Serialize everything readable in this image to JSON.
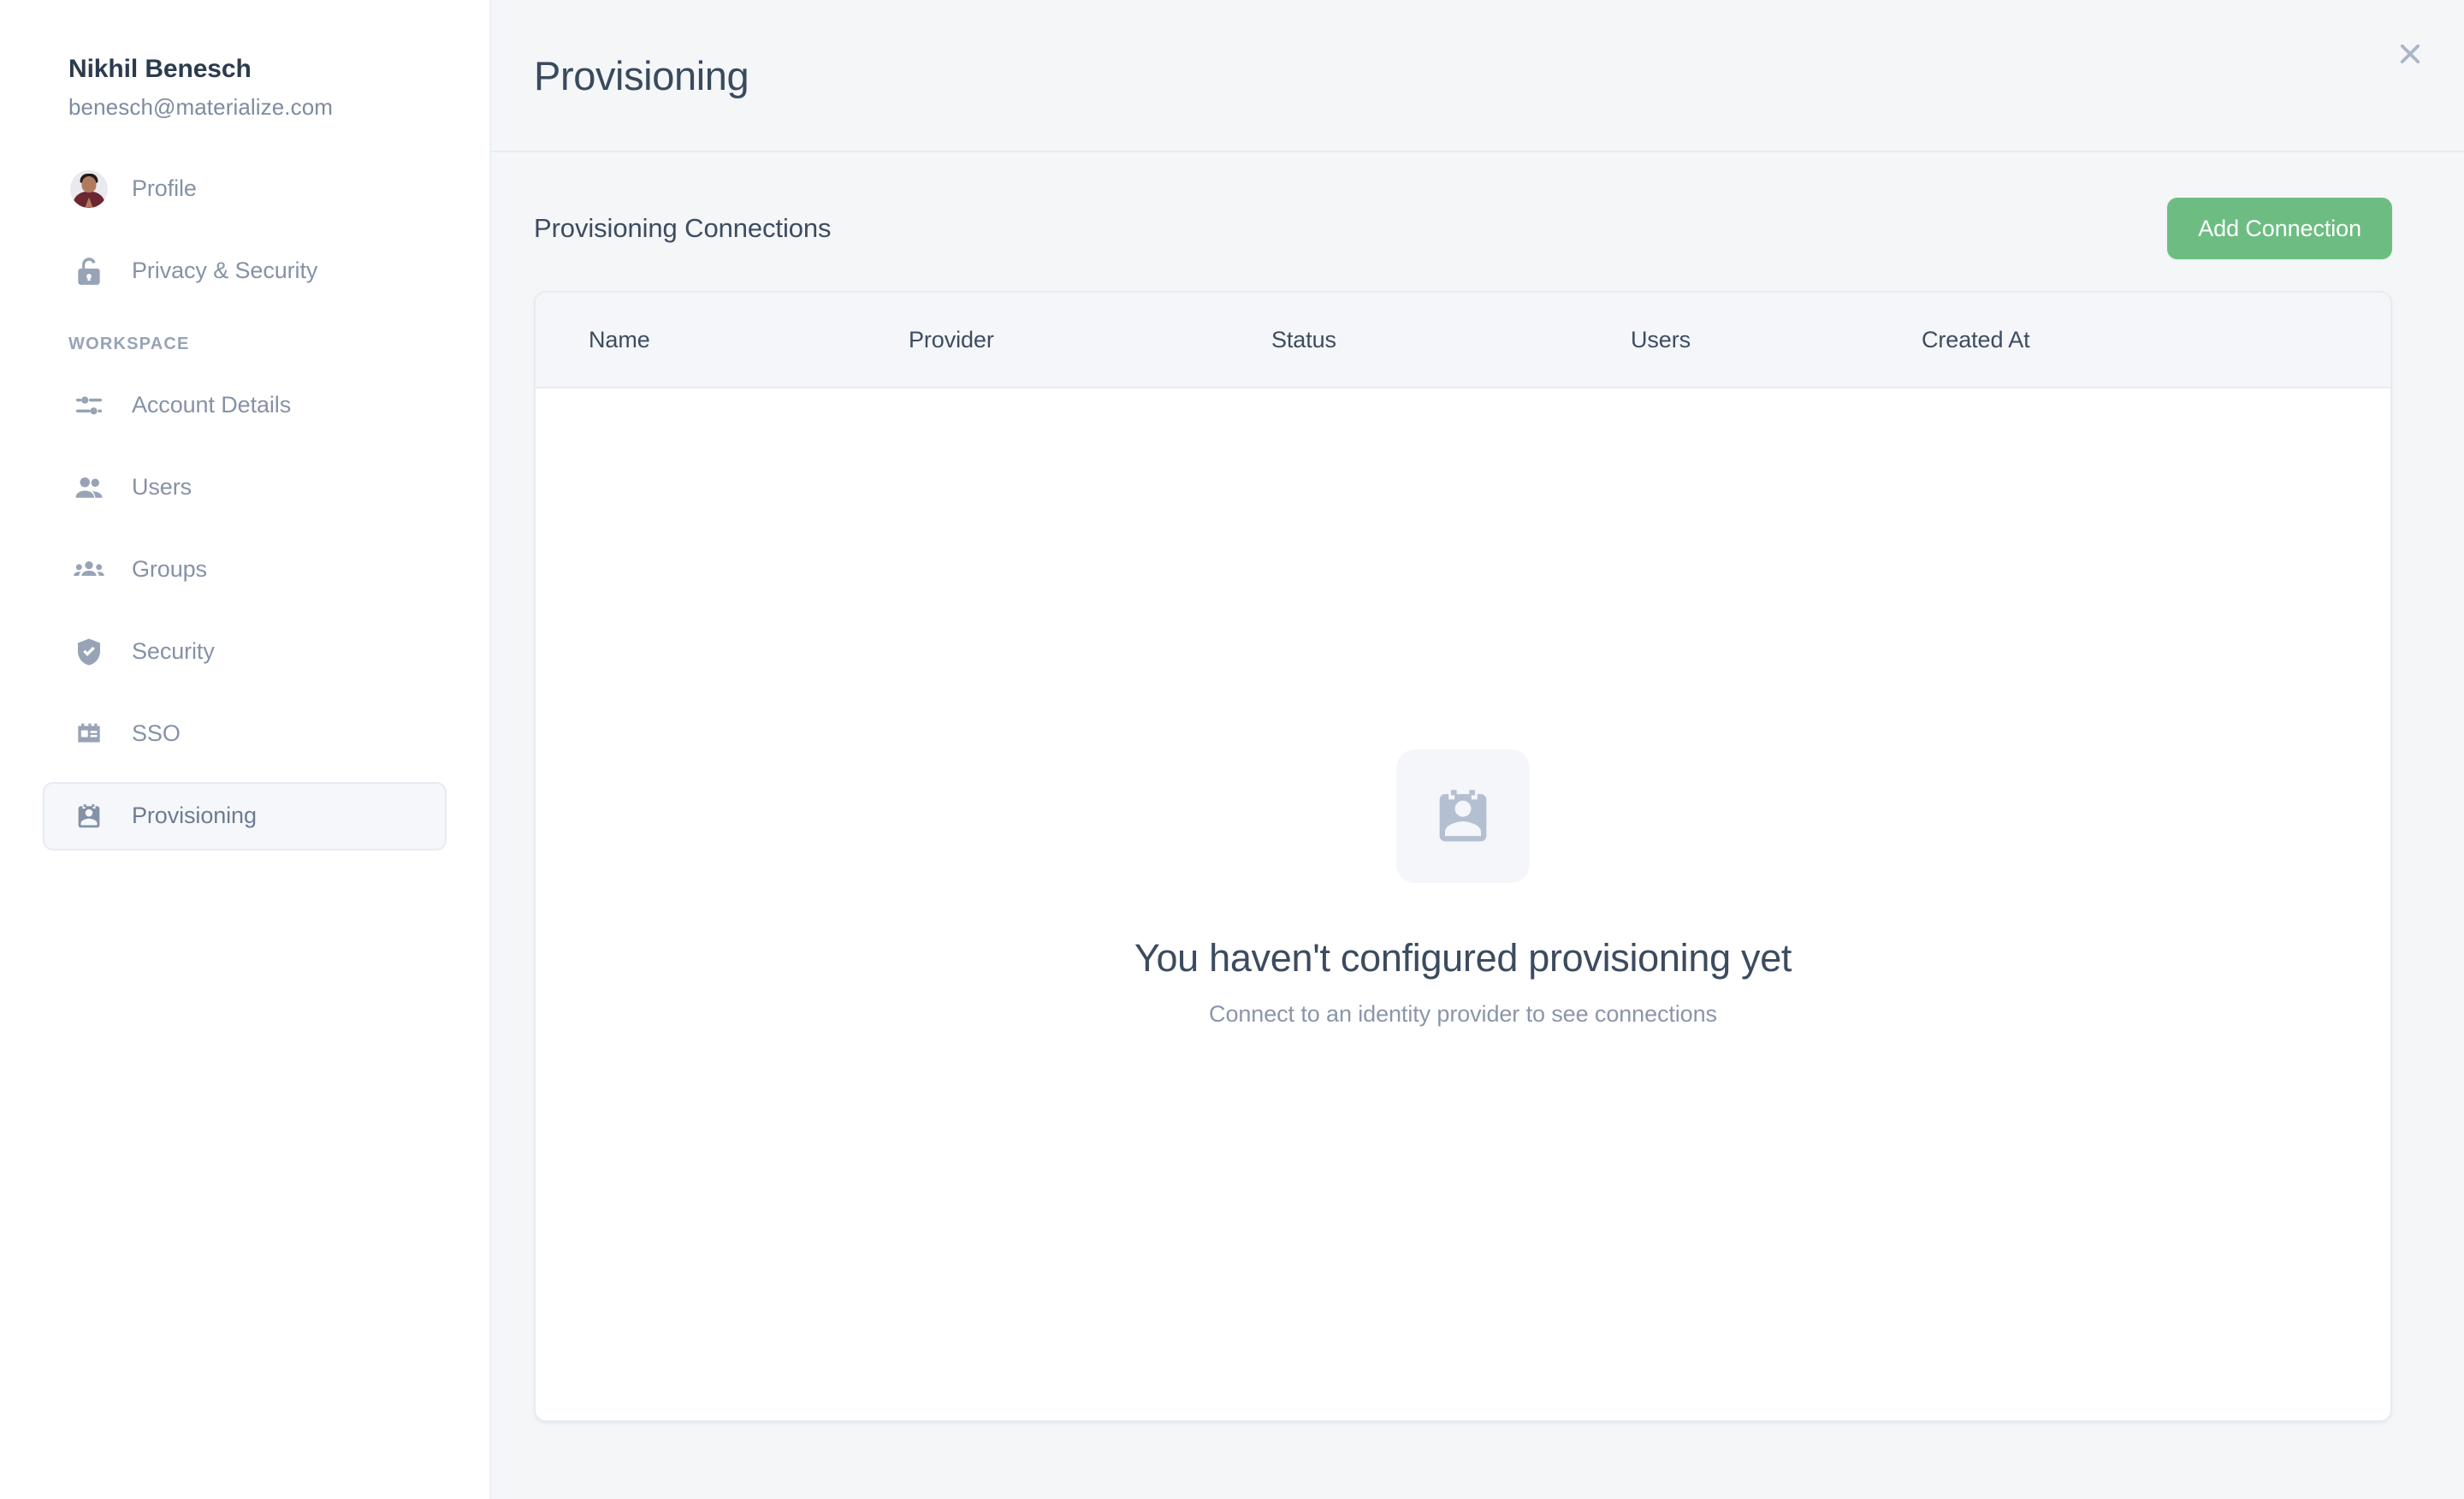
{
  "sidebar": {
    "user": {
      "name": "Nikhil Benesch",
      "email": "benesch@materialize.com"
    },
    "top_items": [
      {
        "label": "Profile",
        "icon": "avatar-photo"
      },
      {
        "label": "Privacy & Security",
        "icon": "unlocked-padlock-icon"
      }
    ],
    "section_label": "WORKSPACE",
    "workspace_items": [
      {
        "label": "Account Details",
        "icon": "sliders-icon",
        "active": false
      },
      {
        "label": "Users",
        "icon": "two-people-icon",
        "active": false
      },
      {
        "label": "Groups",
        "icon": "group-people-icon",
        "active": false
      },
      {
        "label": "Security",
        "icon": "shield-check-icon",
        "active": false
      },
      {
        "label": "SSO",
        "icon": "id-badge-icon",
        "active": false
      },
      {
        "label": "Provisioning",
        "icon": "assignment-person-icon",
        "active": true
      }
    ]
  },
  "header": {
    "title": "Provisioning",
    "close_icon": "close-icon"
  },
  "content": {
    "section_title": "Provisioning Connections",
    "add_button_label": "Add Connection",
    "table": {
      "columns": [
        "Name",
        "Provider",
        "Status",
        "Users",
        "Created At"
      ],
      "rows": []
    },
    "empty_state": {
      "icon": "assignment-person-icon",
      "title": "You haven't configured provisioning yet",
      "subtitle": "Connect to an identity provider to see connections"
    }
  },
  "colors": {
    "accent_green": "#6dbd83",
    "page_background": "#f4f6f8",
    "card_background": "#ffffff",
    "border": "#e7ebf1",
    "text_primary": "#3d4c60",
    "text_muted": "#8592a6"
  }
}
